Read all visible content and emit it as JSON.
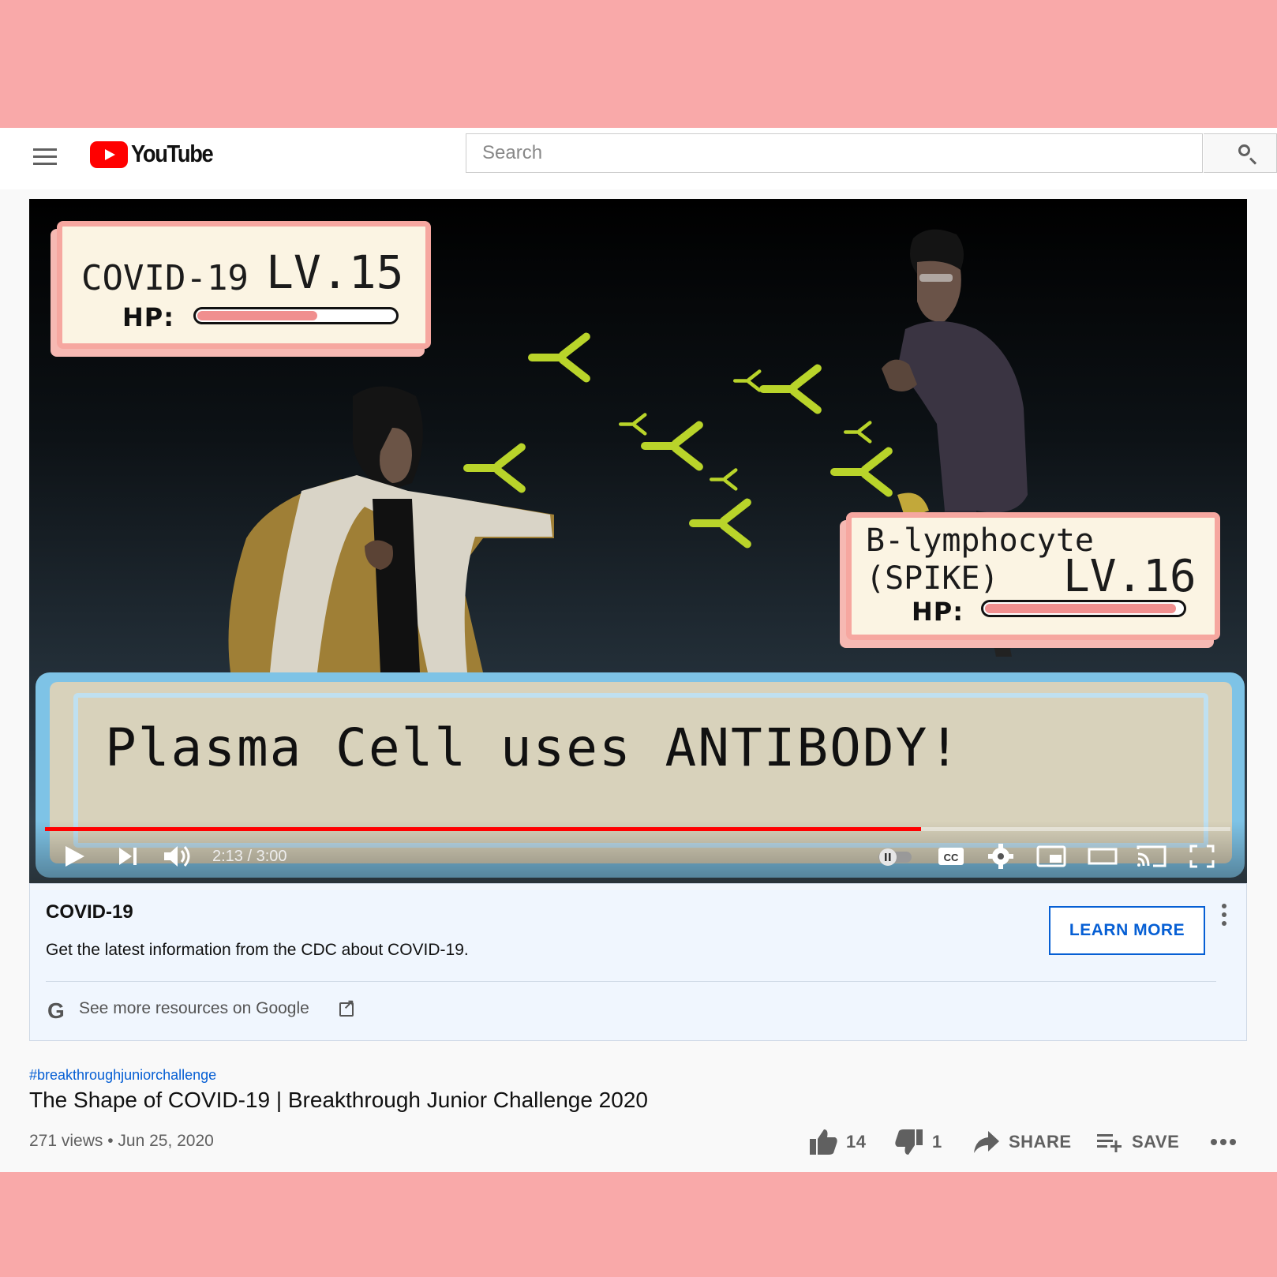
{
  "header": {
    "logo_text": "YouTube",
    "search_placeholder": "Search"
  },
  "video": {
    "enemy": {
      "name": "COVID-19",
      "level": "LV.15",
      "hp_label": "HP:",
      "hp_fraction": 0.6
    },
    "player": {
      "name_line1": "B-lymphocyte",
      "name_line2": "(SPIKE)",
      "level": "LV.16",
      "hp_label": "HP:",
      "hp_fraction": 0.97
    },
    "battle_text": "Plasma Cell uses ANTIBODY!",
    "progress_fraction": 0.739,
    "time": "2:13 / 3:00",
    "colors": {
      "progress": "#ff0000",
      "antibody": "#b9d42a",
      "textbox_border": "#7ec3e6"
    }
  },
  "info_panel": {
    "title": "COVID-19",
    "description": "Get the latest information from the CDC about COVID-19.",
    "button_label": "LEARN MORE",
    "google_link": "See more resources on Google"
  },
  "meta": {
    "hashtag": "#breakthroughjuniorchallenge",
    "title": "The Shape of COVID-19 | Breakthrough Junior Challenge 2020",
    "views_date": "271 views • Jun 25, 2020",
    "likes": "14",
    "dislikes": "1",
    "share_label": "SHARE",
    "save_label": "SAVE"
  }
}
